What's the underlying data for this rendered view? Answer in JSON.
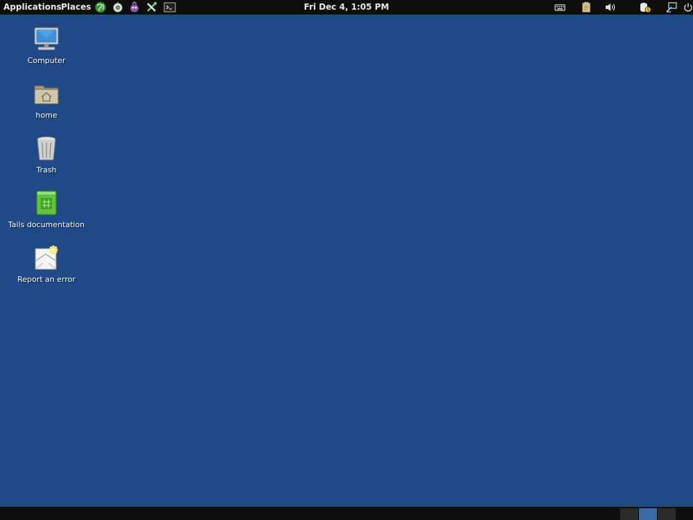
{
  "top_panel": {
    "applications_label": "Applications",
    "places_label": "Places",
    "launchers": [
      {
        "icon": "globe-browser-icon"
      },
      {
        "icon": "onion-circuit-icon"
      },
      {
        "icon": "pidgin-messenger-icon"
      },
      {
        "icon": "keepassx-tools-icon"
      },
      {
        "icon": "terminal-icon"
      }
    ],
    "clock": "Fri Dec  4,  1:05 PM",
    "tray": [
      {
        "icon": "keyboard-icon"
      },
      {
        "icon": "clipboard-icon"
      },
      {
        "icon": "volume-icon"
      },
      {
        "icon": "tor-status-icon"
      },
      {
        "icon": "accessibility-icon"
      },
      {
        "icon": "power-icon"
      }
    ]
  },
  "desktop": {
    "icons": [
      {
        "label": "Computer",
        "icon": "computer-icon"
      },
      {
        "label": "home",
        "icon": "home-folder-icon"
      },
      {
        "label": "Trash",
        "icon": "trash-icon"
      },
      {
        "label": "Tails documentation",
        "icon": "documentation-icon"
      },
      {
        "label": "Report an error",
        "icon": "report-error-icon"
      }
    ]
  },
  "bottom_panel": {
    "workspaces": [
      {
        "name": "workspace-1",
        "active": false
      },
      {
        "name": "workspace-2",
        "active": true
      },
      {
        "name": "workspace-3",
        "active": false
      }
    ]
  },
  "colors": {
    "desktop_background": "#204a87",
    "panel_background": "#0e0e0e",
    "panel_text": "#e8e8e8",
    "active_workspace": "#3b6ba5"
  }
}
